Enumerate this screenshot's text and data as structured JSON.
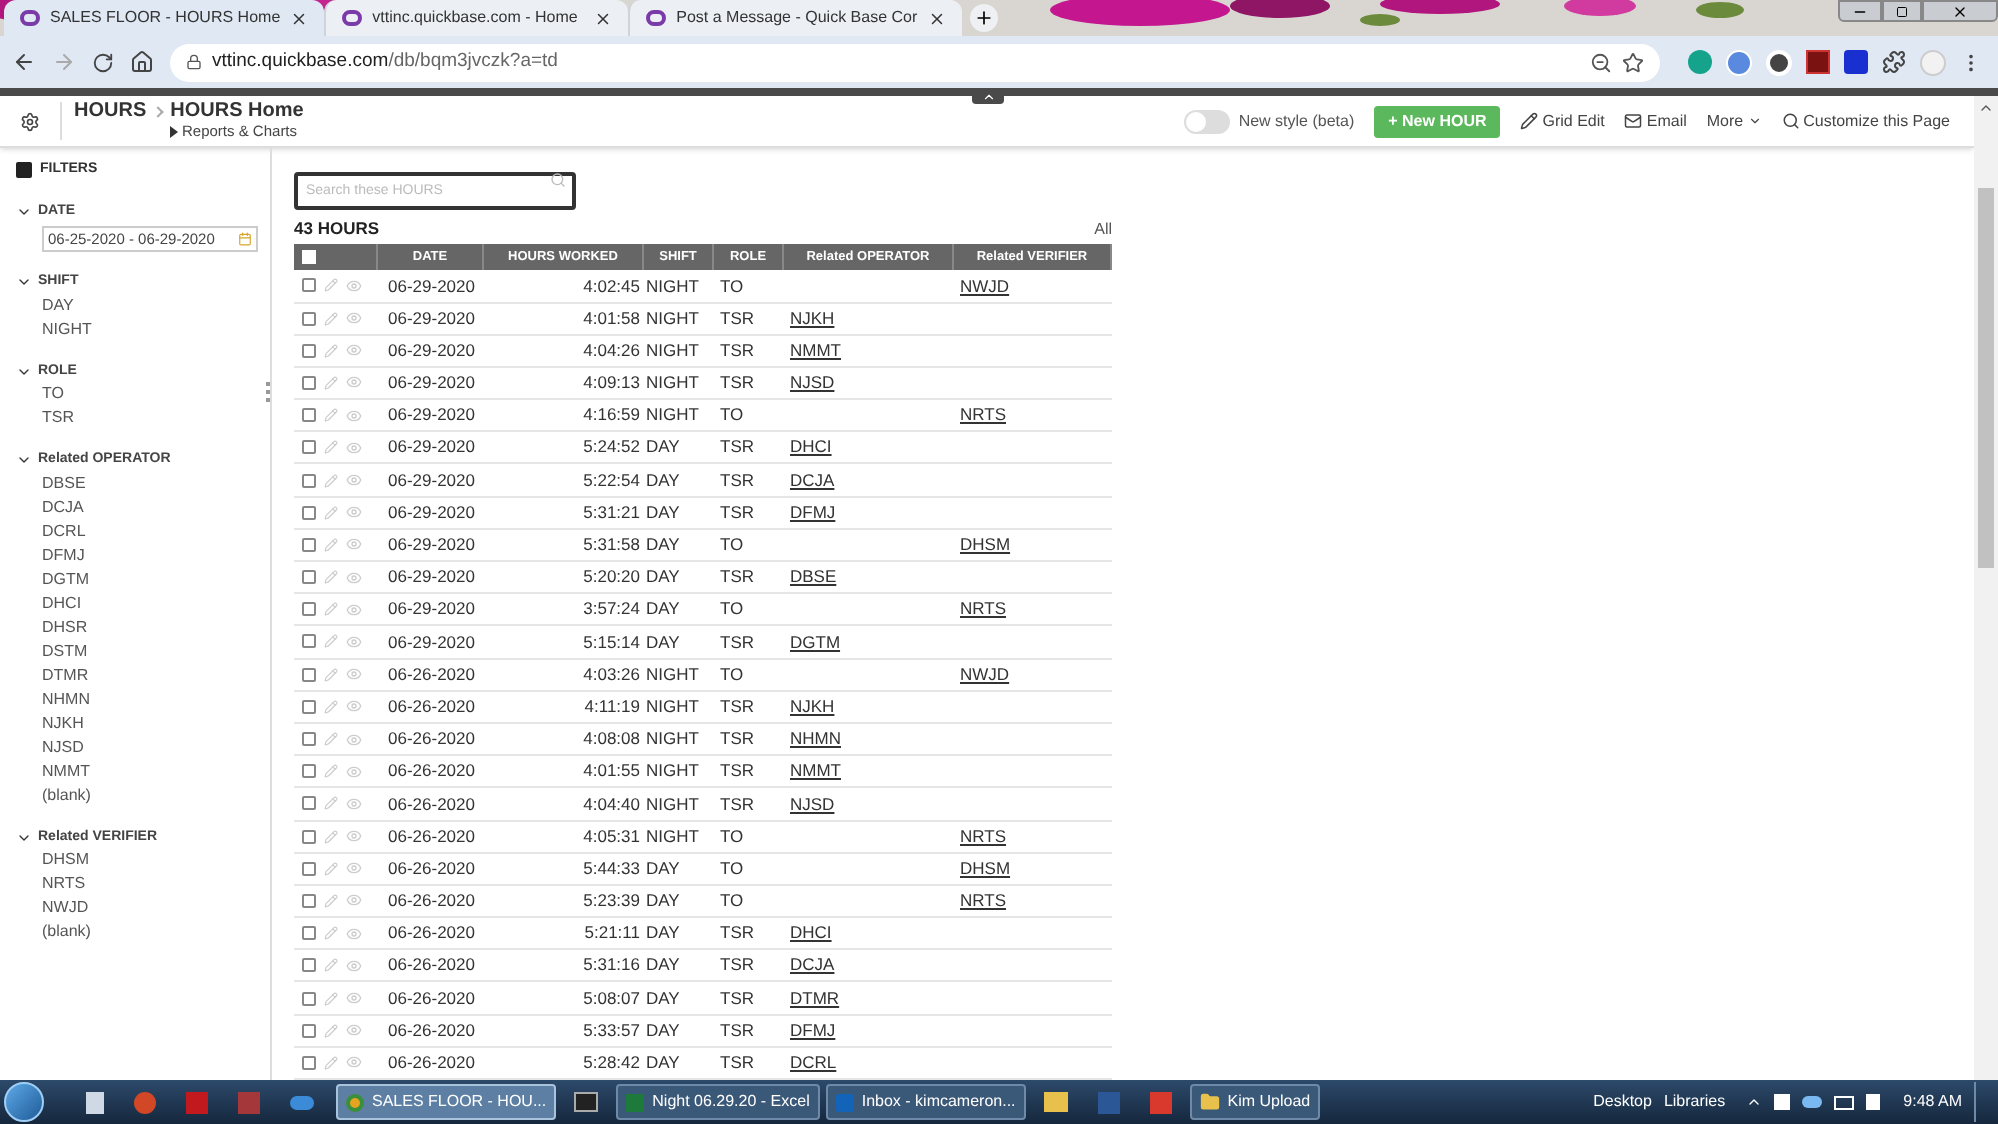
{
  "browser": {
    "tabs": [
      {
        "title": "SALES FLOOR - HOURS Home",
        "selected": true
      },
      {
        "title": "vttinc.quickbase.com - Home",
        "selected": false
      },
      {
        "title": "Post a Message - Quick Base Cor",
        "selected": false
      }
    ],
    "url_host": "vttinc.quickbase.com",
    "url_path": "/db/bqm3jvczk?a=td"
  },
  "header": {
    "table": "HOURS",
    "page": "HOURS Home",
    "subtitle": "Reports & Charts",
    "new_style": {
      "label": "New style (beta)",
      "on": false
    },
    "new_button": "+ New HOUR",
    "actions": [
      "Grid Edit",
      "Email",
      "More",
      "Customize this Page"
    ]
  },
  "filters": {
    "title": "FILTERS",
    "groups": [
      {
        "title": "DATE",
        "expanded": true,
        "kind": "range",
        "value": "06-25-2020 - 06-29-2020"
      },
      {
        "title": "SHIFT",
        "expanded": true,
        "kind": "list",
        "items": [
          "DAY",
          "NIGHT"
        ]
      },
      {
        "title": "ROLE",
        "expanded": true,
        "kind": "list",
        "items": [
          "TO",
          "TSR"
        ]
      },
      {
        "title": "Related OPERATOR",
        "expanded": true,
        "kind": "list",
        "items": [
          "DBSE",
          "DCJA",
          "DCRL",
          "DFMJ",
          "DGTM",
          "DHCI",
          "DHSR",
          "DSTM",
          "DTMR",
          "NHMN",
          "NJKH",
          "NJSD",
          "NMMT",
          "(blank)"
        ]
      },
      {
        "title": "Related VERIFIER",
        "expanded": true,
        "kind": "list",
        "items": [
          "DHSM",
          "NRTS",
          "NWJD",
          "(blank)"
        ]
      }
    ]
  },
  "report": {
    "search_placeholder": "Search these HOURS",
    "select_all_checked": false,
    "count": "43 HOURS",
    "all_link": "All",
    "columns": [
      "DATE",
      "HOURS WORKED",
      "SHIFT",
      "ROLE",
      "Related OPERATOR",
      "Related VERIFIER"
    ],
    "rows": [
      {
        "checked": false,
        "date": "06-29-2020",
        "hours": "4:02:45",
        "shift": "NIGHT",
        "role": "TO",
        "verifier": "NWJD"
      },
      {
        "checked": false,
        "date": "06-29-2020",
        "hours": "4:01:58",
        "shift": "NIGHT",
        "role": "TSR",
        "operator": "NJKH"
      },
      {
        "checked": false,
        "date": "06-29-2020",
        "hours": "4:04:26",
        "shift": "NIGHT",
        "role": "TSR",
        "operator": "NMMT"
      },
      {
        "checked": false,
        "date": "06-29-2020",
        "hours": "4:09:13",
        "shift": "NIGHT",
        "role": "TSR",
        "operator": "NJSD"
      },
      {
        "checked": false,
        "date": "06-29-2020",
        "hours": "4:16:59",
        "shift": "NIGHT",
        "role": "TO",
        "verifier": "NRTS"
      },
      {
        "checked": false,
        "date": "06-29-2020",
        "hours": "5:24:52",
        "shift": "DAY",
        "role": "TSR",
        "operator": "DHCI"
      },
      {
        "checked": false,
        "date": "06-29-2020",
        "hours": "5:22:54",
        "shift": "DAY",
        "role": "TSR",
        "operator": "DCJA"
      },
      {
        "checked": false,
        "date": "06-29-2020",
        "hours": "5:31:21",
        "shift": "DAY",
        "role": "TSR",
        "operator": "DFMJ"
      },
      {
        "checked": false,
        "date": "06-29-2020",
        "hours": "5:31:58",
        "shift": "DAY",
        "role": "TO",
        "verifier": "DHSM"
      },
      {
        "checked": false,
        "date": "06-29-2020",
        "hours": "5:20:20",
        "shift": "DAY",
        "role": "TSR",
        "operator": "DBSE"
      },
      {
        "checked": false,
        "date": "06-29-2020",
        "hours": "3:57:24",
        "shift": "DAY",
        "role": "TO",
        "verifier": "NRTS"
      },
      {
        "checked": false,
        "date": "06-29-2020",
        "hours": "5:15:14",
        "shift": "DAY",
        "role": "TSR",
        "operator": "DGTM"
      },
      {
        "checked": false,
        "date": "06-26-2020",
        "hours": "4:03:26",
        "shift": "NIGHT",
        "role": "TO",
        "verifier": "NWJD"
      },
      {
        "checked": false,
        "date": "06-26-2020",
        "hours": "4:11:19",
        "shift": "NIGHT",
        "role": "TSR",
        "operator": "NJKH"
      },
      {
        "checked": false,
        "date": "06-26-2020",
        "hours": "4:08:08",
        "shift": "NIGHT",
        "role": "TSR",
        "operator": "NHMN"
      },
      {
        "checked": false,
        "date": "06-26-2020",
        "hours": "4:01:55",
        "shift": "NIGHT",
        "role": "TSR",
        "operator": "NMMT"
      },
      {
        "checked": false,
        "date": "06-26-2020",
        "hours": "4:04:40",
        "shift": "NIGHT",
        "role": "TSR",
        "operator": "NJSD"
      },
      {
        "checked": false,
        "date": "06-26-2020",
        "hours": "4:05:31",
        "shift": "NIGHT",
        "role": "TO",
        "verifier": "NRTS"
      },
      {
        "checked": false,
        "date": "06-26-2020",
        "hours": "5:44:33",
        "shift": "DAY",
        "role": "TO",
        "verifier": "DHSM"
      },
      {
        "checked": false,
        "date": "06-26-2020",
        "hours": "5:23:39",
        "shift": "DAY",
        "role": "TO",
        "verifier": "NRTS"
      },
      {
        "checked": false,
        "date": "06-26-2020",
        "hours": "5:21:11",
        "shift": "DAY",
        "role": "TSR",
        "operator": "DHCI"
      },
      {
        "checked": false,
        "date": "06-26-2020",
        "hours": "5:31:16",
        "shift": "DAY",
        "role": "TSR",
        "operator": "DCJA"
      },
      {
        "checked": false,
        "date": "06-26-2020",
        "hours": "5:08:07",
        "shift": "DAY",
        "role": "TSR",
        "operator": "DTMR"
      },
      {
        "checked": false,
        "date": "06-26-2020",
        "hours": "5:33:57",
        "shift": "DAY",
        "role": "TSR",
        "operator": "DFMJ"
      },
      {
        "checked": false,
        "date": "06-26-2020",
        "hours": "5:28:42",
        "shift": "DAY",
        "role": "TSR",
        "operator": "DCRL"
      }
    ]
  },
  "taskbar": {
    "windows": [
      {
        "title": "SALES FLOOR - HOU...",
        "kind": "browser",
        "selected": true
      },
      {
        "title": "Night 06.29.20 - Excel",
        "kind": "excel",
        "selected": false
      },
      {
        "title": "Inbox - kimcameron...",
        "kind": "outlook",
        "selected": false
      },
      {
        "title": "Kim Upload",
        "kind": "folder",
        "selected": false
      }
    ],
    "toolbars": [
      "Desktop",
      "Libraries"
    ],
    "time": "9:48 AM"
  }
}
